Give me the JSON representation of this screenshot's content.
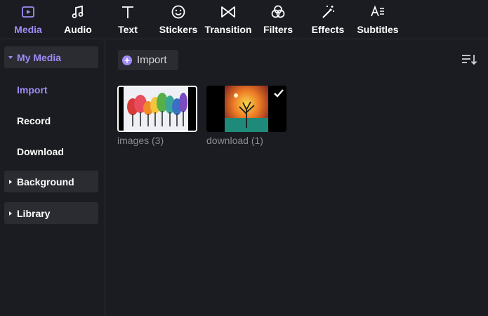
{
  "toolbar": {
    "tabs": [
      {
        "label": "Media",
        "icon": "media-icon",
        "active": true
      },
      {
        "label": "Audio",
        "icon": "music-note-icon",
        "active": false
      },
      {
        "label": "Text",
        "icon": "text-icon",
        "active": false
      },
      {
        "label": "Stickers",
        "icon": "smiley-icon",
        "active": false
      },
      {
        "label": "Transition",
        "icon": "bowtie-icon",
        "active": false
      },
      {
        "label": "Filters",
        "icon": "three-circles-icon",
        "active": false
      },
      {
        "label": "Effects",
        "icon": "magic-wand-icon",
        "active": false
      },
      {
        "label": "Subtitles",
        "icon": "subtitles-icon",
        "active": false
      }
    ]
  },
  "sidebar": {
    "my_media": {
      "label": "My Media",
      "expanded": true
    },
    "items": [
      {
        "label": "Import",
        "active": true
      },
      {
        "label": "Record",
        "active": false
      },
      {
        "label": "Download",
        "active": false
      }
    ],
    "background": {
      "label": "Background",
      "expanded": false
    },
    "library": {
      "label": "Library",
      "expanded": false
    }
  },
  "main": {
    "import_label": "Import",
    "sort_icon": "sort-icon",
    "folders": [
      {
        "caption": "images (3)",
        "selected": true
      },
      {
        "caption": "download (1)",
        "checked": true
      }
    ]
  },
  "colors": {
    "accent": "#9f8cf6",
    "background": "#1b1c21",
    "panel": "#2b2c32",
    "caption": "#8a8b93"
  }
}
